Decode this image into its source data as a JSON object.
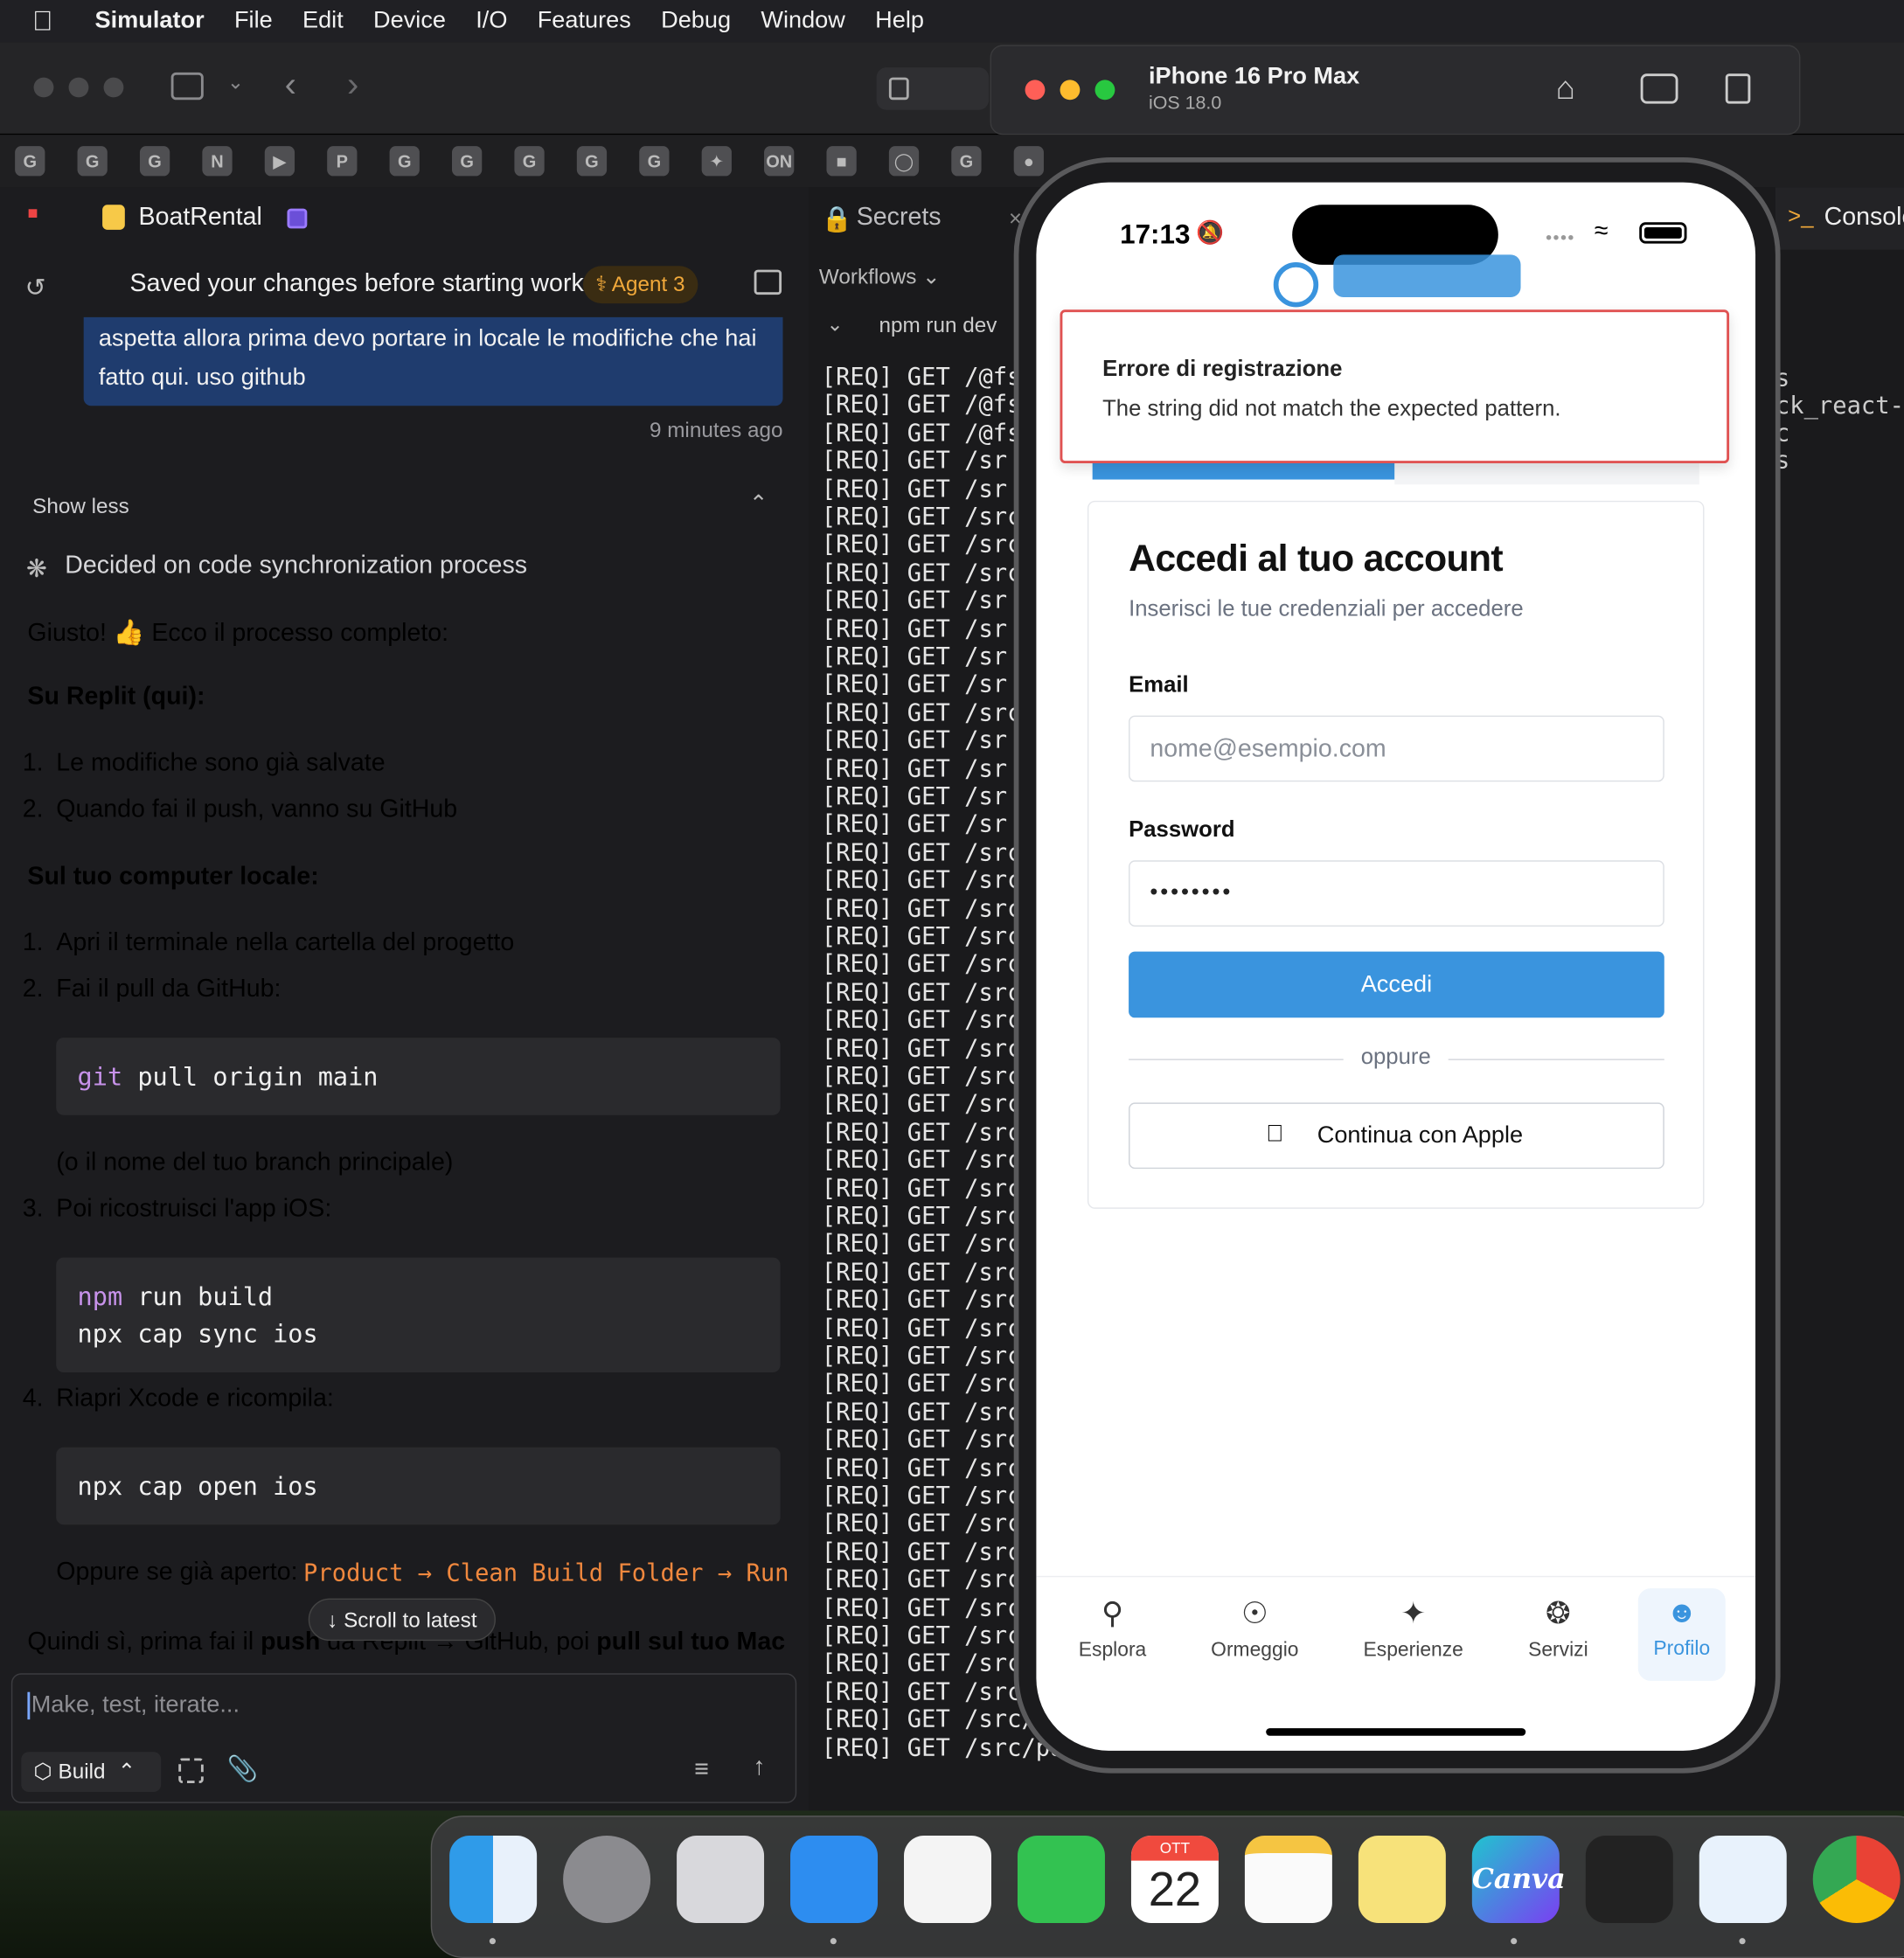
{
  "menubar": {
    "app_name": "Simulator",
    "items": [
      "File",
      "Edit",
      "Device",
      "I/O",
      "Features",
      "Debug",
      "Window",
      "Help"
    ]
  },
  "simulator": {
    "device_name": "iPhone 16 Pro Max",
    "os_version": "iOS 18.0"
  },
  "workspace": {
    "project_name": "BoatRental",
    "secrets_tab": "Secrets",
    "console_tab": "Console",
    "workflows_label": "Workflows",
    "workflow_run": "npm run dev",
    "behind_text": "ck_react-c",
    "behind_text2": "s",
    "behind_text3": "s"
  },
  "agent": {
    "status_text": "Saved your changes before starting work",
    "agent_badge": "Agent 3",
    "user_message": "aspetta allora prima devo portare in locale le modifiche che hai fatto qui. uso github",
    "timestamp": "9 minutes ago",
    "show_less": "Show less",
    "decided": "Decided on code synchronization process",
    "intro": "Giusto! 👍 Ecco il processo completo:",
    "section1_title": "Su Replit (qui):",
    "section1_items": [
      "Le modifiche sono già salvate",
      "Quando fai il push, vanno su GitHub"
    ],
    "section2_title": "Sul tuo computer locale:",
    "section2_items": [
      "Apri il terminale nella cartella del progetto",
      "Fai il pull da GitHub:",
      "Poi ricostruisci l'app iOS:",
      "Riapri Xcode e ricompila:"
    ],
    "code1_keyword": "git",
    "code1_rest": " pull origin main",
    "branch_note": "(o il nome del tuo branch principale)",
    "code2_keyword": "npm",
    "code2_rest": " run build",
    "code2_line2": "npx cap sync ios",
    "code3": "npx cap open ios",
    "alt_prefix": "Oppure se già aperto:",
    "alt_path": "Product → Clean Build Folder → Run",
    "summary_a": "Quindi sì, prima fai il ",
    "summary_b": "push",
    "summary_c": " da Replit → GitHub, poi ",
    "summary_d": "pull sul tuo Mac",
    "scroll_to_latest": "Scroll to latest",
    "input_placeholder": "Make, test, iterate...",
    "build_label": "Build"
  },
  "console_lines": [
    "[REQ] GET /@fs",
    "[REQ] GET /@fs",
    "[REQ] GET /@fs",
    "[REQ] GET /sr",
    "[REQ] GET /sr",
    "[REQ] GET /src",
    "[REQ] GET /src",
    "[REQ] GET /src",
    "[REQ] GET /sr",
    "[REQ] GET /sr",
    "[REQ] GET /sr",
    "[REQ] GET /sr",
    "[REQ] GET /src",
    "[REQ] GET /sr",
    "[REQ] GET /sr",
    "[REQ] GET /sr",
    "[REQ] GET /sr",
    "[REQ] GET /src",
    "[REQ] GET /src",
    "[REQ] GET /src",
    "[REQ] GET /src",
    "[REQ] GET /src",
    "[REQ] GET /src",
    "[REQ] GET /src",
    "[REQ] GET /src",
    "[REQ] GET /src",
    "[REQ] GET /src",
    "[REQ] GET /src",
    "[REQ] GET /src",
    "[REQ] GET /src",
    "[REQ] GET /src",
    "[REQ] GET /src",
    "[REQ] GET /src",
    "[REQ] GET /src",
    "[REQ] GET /src",
    "[REQ] GET /src",
    "[REQ] GET /src",
    "[REQ] GET /src",
    "[REQ] GET /src",
    "[REQ] GET /src",
    "[REQ] GET /src",
    "[REQ] GET /src",
    "[REQ] GET /src",
    "[REQ] GET /src",
    "[REQ] GET /src",
    "[REQ] GET /src",
    "[REQ] GET /src",
    "[REQ] GET /src/",
    "[REQ] GET /src/pages/gestione-prenotazioni.tsx",
    "[REQ] GET /src/pages/analytics-page.tsx"
  ],
  "phone": {
    "time": "17:13",
    "error_title": "Errore di registrazione",
    "error_message": "The string did not match the expected pattern.",
    "login_title": "Accedi al tuo account",
    "login_subtitle": "Inserisci le tue credenziali per accedere",
    "email_label": "Email",
    "email_placeholder": "nome@esempio.com",
    "password_label": "Password",
    "password_value": "••••••••",
    "submit_label": "Accedi",
    "divider_text": "oppure",
    "apple_button": "Continua con Apple",
    "nav": [
      "Esplora",
      "Ormeggio",
      "Esperienze",
      "Servizi",
      "Profilo"
    ]
  },
  "dock": {
    "calendar_month": "OTT",
    "calendar_day": "22",
    "canva_label": "Canva"
  },
  "colors": {
    "accent": "#3a94de",
    "error_border": "#e05252",
    "code_keyword": "#c792ea",
    "path_orange": "#f0883e"
  }
}
